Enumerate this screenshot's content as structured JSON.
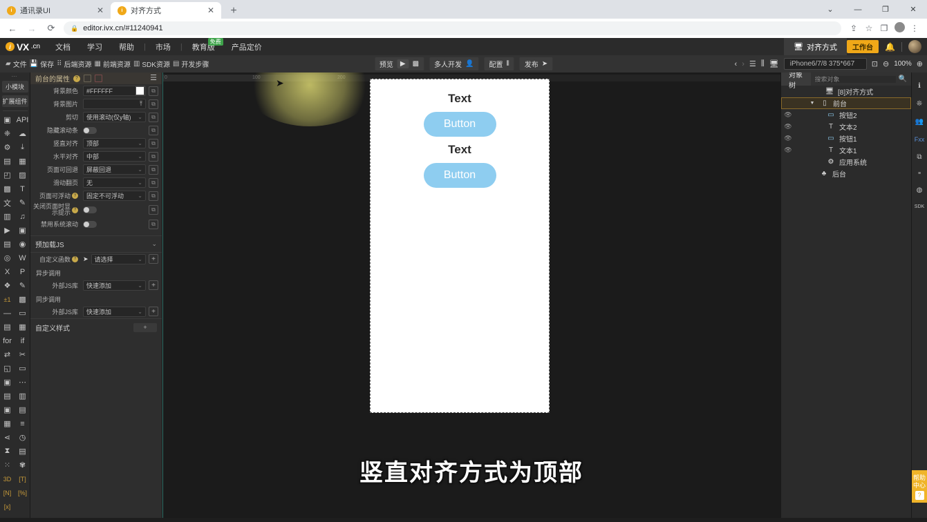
{
  "browser": {
    "tabs": [
      {
        "title": "通讯录UI",
        "active": false
      },
      {
        "title": "对齐方式",
        "active": true
      }
    ],
    "new_tab": "+",
    "window_controls": [
      "⌄",
      "—",
      "❐",
      "✕"
    ],
    "nav": {
      "back": "←",
      "forward": "→",
      "reload": "⟳",
      "lock": "🔒"
    },
    "url": "editor.ivx.cn/#11240941",
    "actions": [
      "⇪",
      "☆",
      "❐",
      "⋮"
    ]
  },
  "app_header": {
    "logo_mark": "i",
    "logo_text": "VX",
    "logo_suffix": ".cn",
    "menu": [
      {
        "label": "文档",
        "badge": null
      },
      {
        "label": "学习",
        "badge": null,
        "caret": true
      },
      {
        "label": "帮助",
        "badge": null
      },
      {
        "label": "市场",
        "badge": null,
        "caret": true
      },
      {
        "label": "教育版",
        "badge": "免费"
      },
      {
        "label": "产品定价",
        "badge": null
      }
    ],
    "project_tab": "对齐方式",
    "workbench_button": "工作台",
    "bell_icon": "bell-icon"
  },
  "toolbar": {
    "left": [
      {
        "label": "文件",
        "icon": "folder-icon"
      },
      {
        "label": "保存",
        "icon": "save-icon"
      },
      {
        "label": "后端资源",
        "icon": "grid-icon"
      },
      {
        "label": "前端资源",
        "icon": "blocks-icon"
      },
      {
        "label": "SDK资源",
        "icon": "sdk-icon"
      },
      {
        "label": "开发步骤",
        "icon": "steps-icon"
      }
    ],
    "center": [
      {
        "label": "预览",
        "icon": "preview-icon"
      },
      {
        "label": "",
        "icon": "play-icon"
      },
      {
        "label": "",
        "icon": "qrcode-icon"
      },
      {
        "label": "多人开发",
        "icon": "users-icon"
      },
      {
        "label": "配置",
        "icon": "sliders-icon"
      },
      {
        "label": "发布",
        "icon": "send-icon"
      }
    ],
    "right": {
      "prev": "‹",
      "next": "›",
      "align_icon": "align-icon",
      "distribute_icon": "distribute-icon",
      "device_icon": "device-icon",
      "device": "iPhone6/7/8 375*667",
      "fit_icon": "fit-icon",
      "zoom_out_icon": "zoom-out-icon",
      "zoom_level": "100%",
      "zoom_in_icon": "zoom-in-icon"
    }
  },
  "rail": {
    "top_dots": "⋯",
    "pills": [
      "小模块",
      "扩展组件"
    ],
    "icons": [
      "box-icon",
      "API",
      "share-nodes-icon",
      "cloud-icon",
      "gear-icon",
      "download-icon",
      "newfile-icon",
      "form-icon",
      "cube-icon",
      "image-icon",
      "picture-icon",
      "text-icon",
      "translate-icon",
      "edit-icon",
      "card-icon",
      "music-icon",
      "video-icon",
      "gallery-icon",
      "window-icon",
      "camera-icon",
      "disc-icon",
      "word-icon",
      "excel-icon",
      "ppt-icon",
      "diagram-icon",
      "paint-icon",
      "±1",
      "qr-icon",
      "line-icon",
      "input-icon",
      "panel-icon",
      "table-grid-icon",
      "for-icon",
      "if-icon",
      "flow-icon",
      "shuffle-icon",
      "page-icon",
      "slider-icon",
      "layout-icon",
      "dots-icon",
      "list-icon",
      "drawer-icon",
      "stack-icon",
      "sort-icon",
      "table-icon",
      "bars-icon",
      "share-icon",
      "clock-icon",
      "hourglass-icon",
      "board-icon",
      "tree-icon",
      "atom-icon",
      "3D",
      "[T]",
      "[N]",
      "[%]",
      "[x]"
    ]
  },
  "properties": {
    "title": "前台的属性",
    "rows": [
      {
        "label": "背景颜色",
        "value": "#FFFFFF",
        "type": "color",
        "swatch": "#FFFFFF"
      },
      {
        "label": "背景图片",
        "value": "",
        "type": "upload"
      },
      {
        "label": "剪切",
        "value": "使用滚动(仅y轴)",
        "type": "select"
      },
      {
        "label": "隐藏滚动条",
        "value": "",
        "type": "toggle"
      },
      {
        "label": "竖直对齐",
        "value": "顶部",
        "type": "select"
      },
      {
        "label": "水平对齐",
        "value": "中部",
        "type": "select"
      },
      {
        "label": "页面可回退",
        "value": "屏蔽回退",
        "type": "select"
      },
      {
        "label": "滑动翻页",
        "value": "无",
        "type": "select"
      },
      {
        "label": "页面可浮动",
        "value": "固定不可浮动",
        "type": "select",
        "help": true
      },
      {
        "label": "关闭页面时显示提示",
        "value": "",
        "type": "toggle",
        "help": true
      },
      {
        "label": "禁用系统滚动",
        "value": "",
        "type": "toggle"
      }
    ],
    "preload_section": {
      "title": "预加载JS",
      "custom_fn_label": "自定义函数",
      "custom_fn_value": "请选择",
      "async_label": "异步调用",
      "async_lib_label": "外部JS库",
      "async_lib_value": "快速添加",
      "sync_label": "同步调用",
      "sync_lib_label": "外部JS库",
      "sync_lib_value": "快速添加"
    },
    "custom_style": {
      "title": "自定义样式",
      "add": "+"
    }
  },
  "canvas": {
    "ruler_labels": [
      "0",
      "100",
      "200"
    ],
    "elements": [
      {
        "type": "text",
        "label": "Text"
      },
      {
        "type": "button",
        "label": "Button"
      },
      {
        "type": "text",
        "label": "Text"
      },
      {
        "type": "button",
        "label": "Button"
      }
    ],
    "button_color": "#8ecdf0",
    "subtitle": "竖直对齐方式为顶部"
  },
  "object_tree": {
    "tab": "对象树",
    "search_placeholder": "搜索对象",
    "search_value": "",
    "nodes": [
      {
        "label": "[8]对齐方式",
        "icon": "app-icon",
        "indent": 0,
        "eye": false,
        "selected": false,
        "chevron": false
      },
      {
        "label": "前台",
        "icon": "phone-icon",
        "indent": 1,
        "eye": false,
        "selected": true,
        "chevron": true
      },
      {
        "label": "按钮2",
        "icon": "button-icon",
        "indent": 2,
        "eye": true,
        "selected": false,
        "chevron": false
      },
      {
        "label": "文本2",
        "icon": "text-icon",
        "indent": 2,
        "eye": true,
        "selected": false,
        "chevron": false
      },
      {
        "label": "按钮1",
        "icon": "button-icon",
        "indent": 2,
        "eye": true,
        "selected": false,
        "chevron": false
      },
      {
        "label": "文本1",
        "icon": "text-icon",
        "indent": 2,
        "eye": true,
        "selected": false,
        "chevron": false
      },
      {
        "label": "应用系统",
        "icon": "gear-icon",
        "indent": 2,
        "eye": false,
        "selected": false,
        "chevron": false
      },
      {
        "label": "后台",
        "icon": "trash-icon",
        "indent": 1,
        "eye": false,
        "selected": false,
        "chevron": false
      }
    ]
  },
  "right_rail": {
    "icons": [
      "info-icon",
      "palette-icon",
      "users-icon",
      "Fxx",
      "copy-icon",
      "code-icon",
      "globe-icon",
      "sdk-icon"
    ]
  },
  "help_tab": {
    "label": "帮助中心",
    "icon": "question-icon"
  },
  "colors": {
    "accent_orange": "#f0a818",
    "button_blue": "#8ecdf0",
    "selection": "#8a6a2a",
    "highlight_glow": "#ebe678"
  }
}
